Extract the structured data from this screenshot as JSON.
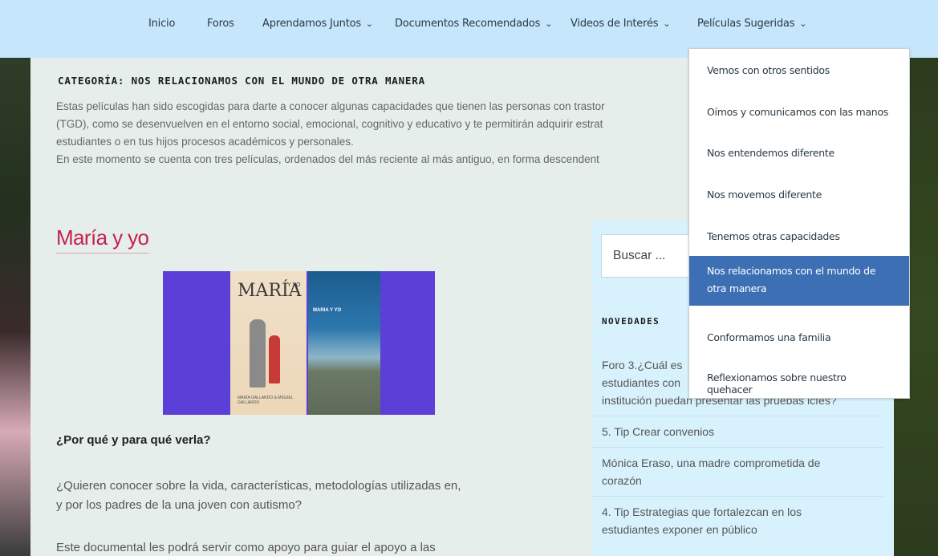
{
  "nav": {
    "items": [
      {
        "label": "Inicio",
        "dropdown": false
      },
      {
        "label": "Foros",
        "dropdown": false
      },
      {
        "label": "Aprendamos Juntos",
        "dropdown": true
      },
      {
        "label": "Documentos Recomendados",
        "dropdown": true
      },
      {
        "label": "Videos de Interés",
        "dropdown": true
      },
      {
        "label": "Películas Sugeridas",
        "dropdown": true
      }
    ],
    "chevron": "⌄"
  },
  "dropdown": {
    "items": [
      "Vemos con otros sentidos",
      "Oímos y comunicamos con las manos",
      "Nos entendemos diferente",
      "Nos movemos diferente",
      "Tenemos otras capacidades",
      "Nos relacionamos con el mundo de otra manera",
      "Conformamos una familia",
      "Reflexionamos sobre nuestro quehacer"
    ],
    "active_index": 5,
    "active_color": "#3c6fb4"
  },
  "category": {
    "title": "CATEGORÍA: NOS RELACIONAMOS CON EL MUNDO DE OTRA MANERA",
    "lines": [
      "Estas películas han sido escogidas para darte a conocer algunas capacidades que tienen las personas con trastor",
      "(TGD), como se desenvuelven en el entorno social, emocional, cognitivo y educativo y te permitirán adquirir estrat",
      "estudiantes o en tus hijos procesos académicos y personales.",
      "En este momento se cuenta con tres películas, ordenados del más reciente al más antiguo, en forma descendent"
    ]
  },
  "post": {
    "title": "María y yo",
    "title_color": "#c4224d",
    "poster_title": "MARÍA",
    "poster_subtitle": "Y YO",
    "poster_credits": "MARÍA GALLARDO & MIGUEL GALLARDO",
    "poster2_title": "MARIA Y YO",
    "why_heading": "¿Por qué y para qué verla?",
    "para1_lines": [
      "¿Quieren conocer sobre la vida, características, metodologías utilizadas en,",
      "y por los padres de la una joven con autismo?"
    ],
    "para2": "Este documental les podrá servir como apoyo para guiar el apoyo a las"
  },
  "sidebar": {
    "search_placeholder": "Buscar ...",
    "novedades_title": "NOVEDADES",
    "news": [
      [
        "Foro 3.¿Cuál es",
        "estudiantes con",
        "institución puedan presentar las pruebas icfes?"
      ],
      [
        "5. Tip Crear convenios"
      ],
      [
        "Mónica Eraso, una madre comprometida de",
        "corazón"
      ],
      [
        "4. Tip Estrategias que fortalezcan en los",
        "estudiantes exponer en público"
      ]
    ]
  },
  "colors": {
    "nav_bg": "#c6e6fb",
    "sidebar_bg": "#d8f2fd",
    "page_bg": "#e6eeec"
  }
}
